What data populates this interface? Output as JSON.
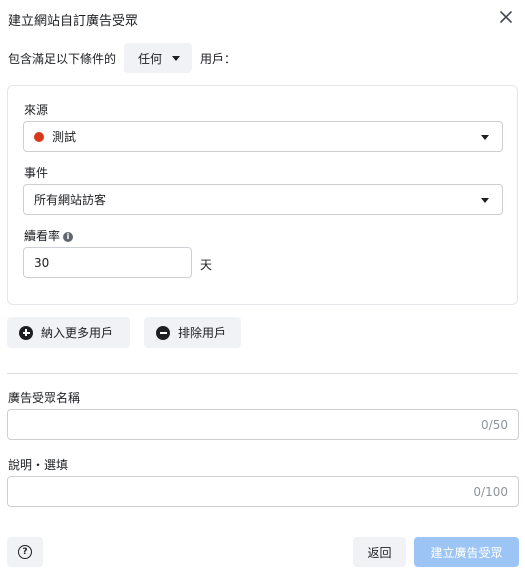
{
  "dialog": {
    "title": "建立網站自訂廣告受眾",
    "close_icon": "close-icon"
  },
  "conditions": {
    "prefix": "包含滿足以下條件的",
    "match_value": "任何",
    "suffix": "用戶："
  },
  "rule": {
    "source_label": "來源",
    "source_value": "測試",
    "source_dot_color": "#d9371c",
    "event_label": "事件",
    "event_value": "所有網站訪客",
    "retention_label": "續看率",
    "retention_info_icon": "info-icon",
    "retention_value": "30",
    "retention_unit": "天"
  },
  "actions": {
    "include_more": "納入更多用戶",
    "exclude": "排除用戶"
  },
  "audience_name": {
    "label": "廣告受眾名稱",
    "value": "",
    "counter": "0/50"
  },
  "description": {
    "label": "說明・選填",
    "value": "",
    "counter": "0/100"
  },
  "footer": {
    "help_icon": "help-icon",
    "back_label": "返回",
    "create_label": "建立廣告受眾",
    "create_color": "#9cc4f5"
  }
}
